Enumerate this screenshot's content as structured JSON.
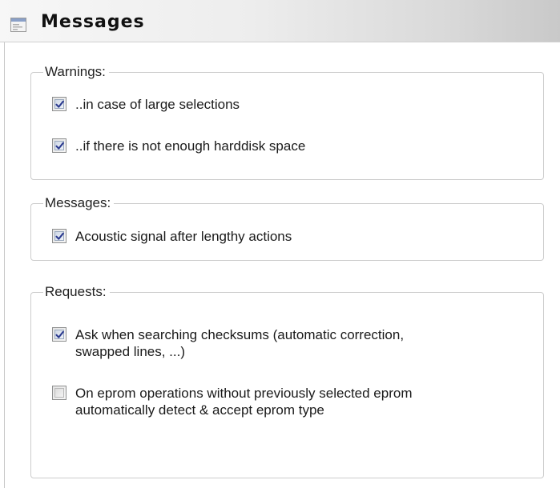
{
  "header": {
    "title": "Messages",
    "icon": "panel-icon"
  },
  "groups": [
    {
      "legend": "Warnings:",
      "options": [
        {
          "label": "..in case of large selections",
          "checked": true
        },
        {
          "label": "..if there is not enough harddisk space",
          "checked": true
        }
      ]
    },
    {
      "legend": "Messages:",
      "options": [
        {
          "label": "Acoustic signal after lengthy actions",
          "checked": true
        }
      ]
    },
    {
      "legend": "Requests:",
      "options": [
        {
          "line1": "Ask when searching checksums (automatic correction,",
          "line2": "swapped lines, ...)",
          "checked": true
        },
        {
          "line1": "On eprom operations without previously selected eprom",
          "line2": "automatically detect & accept eprom type",
          "checked": false
        }
      ]
    }
  ],
  "colors": {
    "check_mark": "#2b3a8f",
    "border": "#cccccc"
  }
}
